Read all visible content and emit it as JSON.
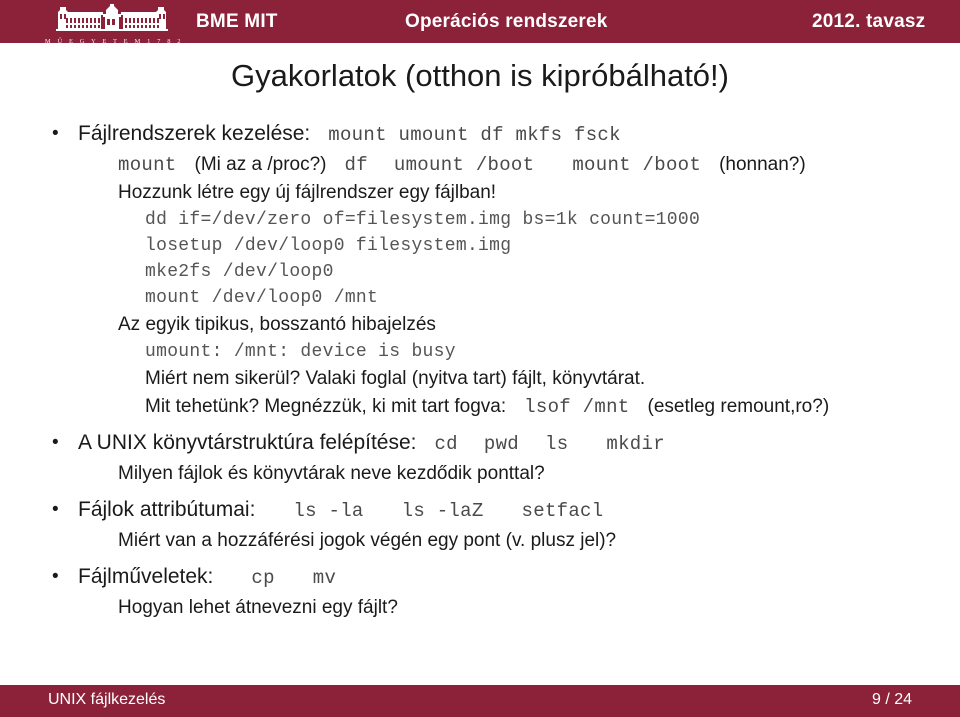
{
  "header": {
    "logo_name": "bme-logo",
    "logo_caption": "M Ű E G Y E T E M   1 7 8 2",
    "left": "BME MIT",
    "middle": "Operációs rendszerek",
    "right": "2012. tavasz",
    "bar_color": "#8b2239"
  },
  "footer": {
    "left": "UNIX fájlkezelés",
    "page": "9 / 24",
    "bar_color": "#8b2239"
  },
  "slide": {
    "title": "Gyakorlatok (otthon is kipróbálható!)",
    "bullet_glyph": "•",
    "lines": {
      "l1_label": "Fájlrendszerek kezelése:",
      "l1_code": "mount umount df mkfs fsck",
      "l2_code_a": "mount",
      "l2_text_a": "(Mi az a /proc?)",
      "l2_code_b": "df",
      "l2_code_c": "umount /boot",
      "l2_code_d": "mount /boot",
      "l2_text_b": "(honnan?)",
      "l3_text": "Hozzunk létre egy új fájlrendszer egy fájlban!",
      "cmd1": "dd if=/dev/zero of=filesystem.img bs=1k count=1000",
      "cmd2": "losetup /dev/loop0 filesystem.img",
      "cmd3": "mke2fs /dev/loop0",
      "cmd4": "mount /dev/loop0 /mnt",
      "l4_text": "Az egyik tipikus, bosszantó hibajelzés",
      "err1": "umount: /mnt: device is busy",
      "l5_text": "Miért nem sikerül? Valaki foglal (nyitva tart) fájlt, könyvtárat.",
      "l6_text_a": "Mit tehetünk? Megnézzük, ki mit tart fogva:",
      "l6_code": "lsof /mnt",
      "l6_text_b": "(esetleg remount,ro?)",
      "l7_label": "A UNIX könyvtárstruktúra felépítése:",
      "l7_code_a": "cd",
      "l7_code_b": "pwd",
      "l7_code_c": "ls",
      "l7_code_d": "mkdir",
      "l8_text": "Milyen fájlok és könyvtárak neve kezdődik ponttal?",
      "l9_label": "Fájlok attribútumai:",
      "l9_code_a": "ls -la",
      "l9_code_b": "ls -laZ",
      "l9_code_c": "setfacl",
      "l10_text": "Miért van a hozzáférési jogok végén egy pont (v. plusz jel)?",
      "l11_label": "Fájlműveletek:",
      "l11_code_a": "cp",
      "l11_code_b": "mv",
      "l12_text": "Hogyan lehet átnevezni egy fájlt?"
    }
  }
}
